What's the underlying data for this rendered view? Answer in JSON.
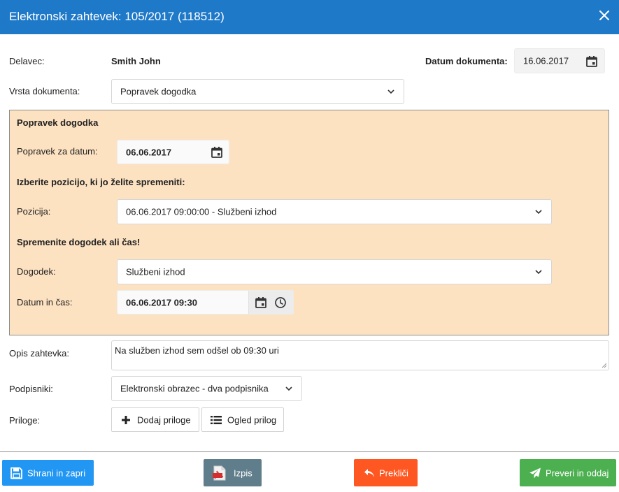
{
  "window": {
    "title": "Elektronski zahtevek: 105/2017 (118512)"
  },
  "header": {
    "worker_label": "Delavec:",
    "worker_value": "Smith John",
    "doc_date_label": "Datum dokumenta:",
    "doc_date_value": "16.06.2017"
  },
  "doc_type": {
    "label": "Vrsta dokumenta:",
    "value": "Popravek dogodka"
  },
  "panel": {
    "heading": "Popravek dogodka",
    "for_date_label": "Popravek za datum:",
    "for_date_value": "06.06.2017",
    "choose_heading": "Izberite pozicijo, ki jo želite spremeniti:",
    "position_label": "Pozicija:",
    "position_value": "06.06.2017 09:00:00 - Službeni izhod",
    "change_heading": "Spremenite dogodek ali čas!",
    "event_label": "Dogodek:",
    "event_value": "Službeni izhod",
    "datetime_label": "Datum in čas:",
    "datetime_value": "06.06.2017 09:30"
  },
  "description": {
    "label": "Opis zahtevka:",
    "value": "Na služben izhod sem odšel ob 09:30 uri"
  },
  "signers": {
    "label": "Podpisniki:",
    "value": "Elektronski obrazec - dva podpisnika"
  },
  "attachments": {
    "label": "Priloge:",
    "add_label": "Dodaj priloge",
    "view_label": "Ogled prilog"
  },
  "footer": {
    "save_label": "Shrani in zapri",
    "print_label": "Izpis",
    "cancel_label": "Prekliči",
    "submit_label": "Preveri in oddaj"
  },
  "colors": {
    "titlebar": "#1e79c9",
    "panel": "#fde2c2",
    "save": "#2196f3",
    "print": "#607d8b",
    "cancel": "#ff5722",
    "submit": "#4caf50"
  }
}
